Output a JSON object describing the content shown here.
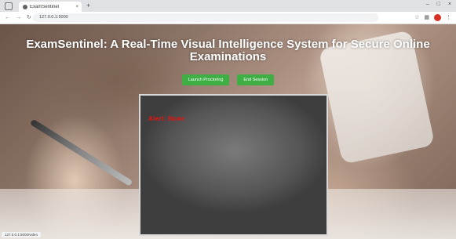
{
  "browser": {
    "tab_title": "ExamSentinel",
    "tab_close": "×",
    "new_tab": "+",
    "url": "127.0.0.1:5000",
    "controls": {
      "minimize": "–",
      "maximize": "□",
      "close": "×"
    }
  },
  "page": {
    "title": "ExamSentinel: A Real-Time Visual Intelligence System for Secure Online Examinations",
    "buttons": {
      "launch": "Launch Proctoring",
      "end": "End Session"
    },
    "camera": {
      "alert": "Alert: None"
    },
    "status_bar": "127.0.0.1:5000/video"
  },
  "colors": {
    "button": "#3fae45",
    "alert": "#ee1111"
  }
}
